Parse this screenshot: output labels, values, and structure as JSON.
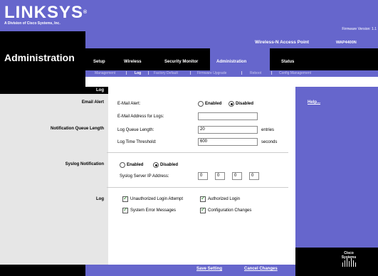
{
  "brand": {
    "logo": "LINKSYS",
    "subtitle": "A Division of Cisco Systems, Inc.",
    "firmware": "Firmware Version: 1.1",
    "product": "Wireless-N Access Point",
    "model": "WAP4400N"
  },
  "page_title": "Administration",
  "tabs": [
    {
      "label": "Setup"
    },
    {
      "label": "Wireless"
    },
    {
      "label": "Security Monitor"
    },
    {
      "label": "Administration"
    },
    {
      "label": "Status"
    }
  ],
  "subtabs": [
    {
      "label": "Management"
    },
    {
      "label": "Log"
    },
    {
      "label": "Factory Default"
    },
    {
      "label": "Firmware Upgrade"
    },
    {
      "label": "Reboot"
    },
    {
      "label": "Config Management"
    }
  ],
  "sections": {
    "log_header": "Log",
    "email_alert": "Email Alert",
    "notification_queue": "Notification Queue Length",
    "syslog": "Syslog Notification",
    "log": "Log"
  },
  "email": {
    "alert_label": "E-Mail Alert:",
    "enabled": "Enabled",
    "disabled": "Disabled",
    "selected": "Disabled",
    "address_label": "E-Mail Address for Logs:",
    "address_value": ""
  },
  "queue": {
    "length_label": "Log Queue Length:",
    "length_value": "20",
    "length_unit": "entries",
    "threshold_label": "Log Time Threshold:",
    "threshold_value": "600",
    "threshold_unit": "seconds"
  },
  "syslog": {
    "enabled": "Enabled",
    "disabled": "Disabled",
    "selected": "Disabled",
    "server_label": "Syslog Server IP Address:",
    "ip": [
      "0",
      "0",
      "0",
      "0"
    ]
  },
  "log_options": {
    "unauthorized_login": "Unauthorized Login Attempt",
    "authorized_login": "Authorized Login",
    "system_error": "System Error Messages",
    "config_changes": "Configuration Changes",
    "checked": [
      true,
      true,
      true,
      true
    ]
  },
  "help_link": "Help...",
  "buttons": {
    "save": "Save Setting",
    "cancel": "Cancel Changes"
  },
  "footer_logo": "Cisco Systems",
  "colors": {
    "accent": "#6666cc",
    "dark": "#000000",
    "panel": "#e6e6e6"
  }
}
